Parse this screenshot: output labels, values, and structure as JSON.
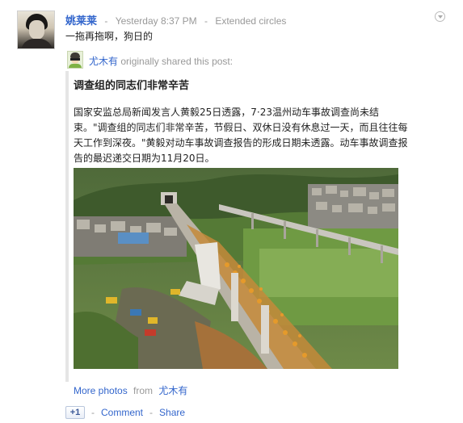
{
  "post": {
    "author": "姚莱莱",
    "separator": "-",
    "timestamp": "Yesterday 8:37 PM",
    "visibility": "Extended circles",
    "text": "一拖再拖啊，狗日的"
  },
  "reshare": {
    "author": "尤木有",
    "suffix": "originally shared this post:",
    "title": "调查组的同志们非常辛苦",
    "body": "国家安监总局新闻发言人黄毅25日透露，7·23温州动车事故调查尚未结束。\"调查组的同志们非常辛苦，节假日、双休日没有休息过一天，而且往往每天工作到深夜。\"黄毅对动车事故调查报告的形成日期未透露。动车事故调查报告的最迟递交日期为11月20日。"
  },
  "more_photos": {
    "link": "More photos",
    "from": "from",
    "author": "尤木有"
  },
  "actions": {
    "plus_one": "+1",
    "separator": "-",
    "comment": "Comment",
    "share": "Share"
  },
  "icons": {
    "menu": "chevron-down-circle-icon",
    "photo": "train-wreck-photo"
  },
  "colors": {
    "link": "#3366cc",
    "meta": "#999999"
  }
}
